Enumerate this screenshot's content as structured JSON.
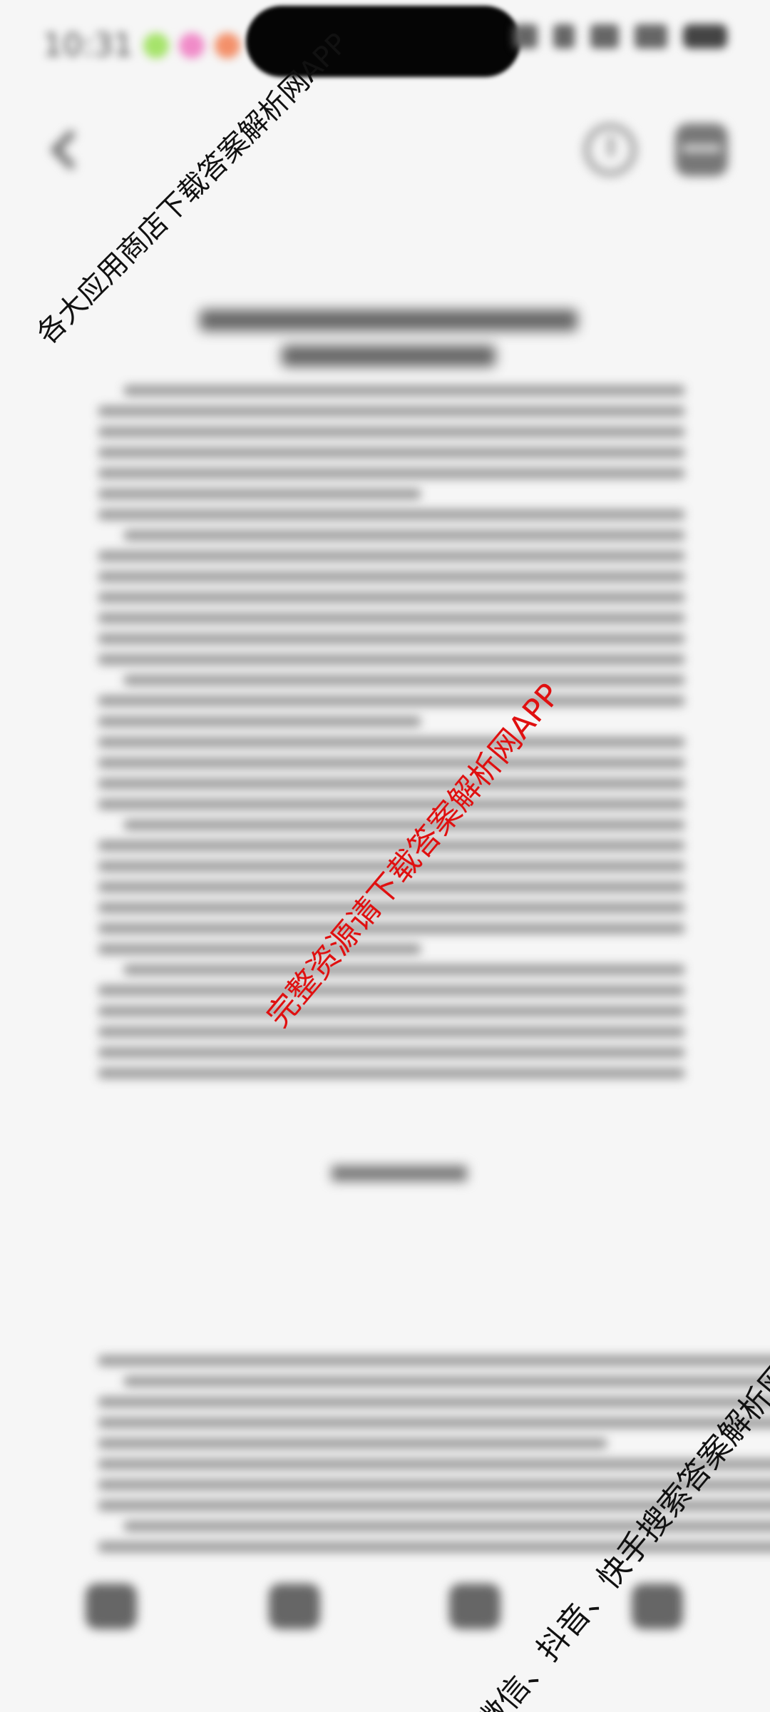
{
  "status_bar": {
    "time": "10:31",
    "dot_colors": [
      "#a6e36b",
      "#f08bc8",
      "#f3906a"
    ]
  },
  "toolbar": {
    "back_icon": "back-arrow-icon",
    "history_icon": "clock-icon",
    "menu_icon": "grid-menu-icon"
  },
  "watermarks": {
    "top_left": "各大应用商店下载答案解析网APP",
    "center": "完整资源请下载答案解析网APP",
    "bottom_right": "微信、抖音、快手搜索答案解析网"
  },
  "bottom_nav": {
    "items": [
      {
        "label": "",
        "icon": "bookshelf-icon"
      },
      {
        "label": "",
        "icon": "document-icon"
      },
      {
        "label": "",
        "icon": "answer-icon"
      },
      {
        "label": "",
        "icon": "more-icon"
      }
    ]
  }
}
